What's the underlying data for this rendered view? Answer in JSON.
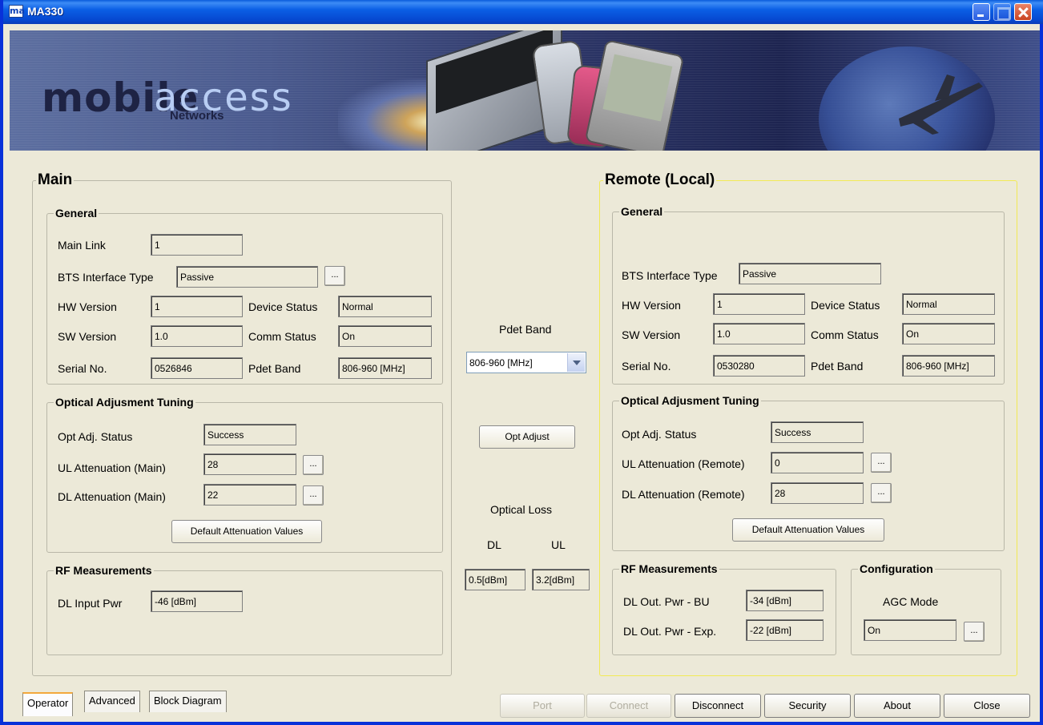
{
  "window": {
    "title": "MA330",
    "icon_text": "ma"
  },
  "banner": {
    "logo_mobile": "mobile",
    "logo_access": "access",
    "logo_networks": "Networks"
  },
  "main": {
    "title": "Main",
    "general": {
      "title": "General",
      "main_link_label": "Main Link",
      "main_link": "1",
      "bts_label": "BTS Interface Type",
      "bts": "Passive",
      "hw_label": "HW Version",
      "hw": "1",
      "sw_label": "SW Version",
      "sw": "1.0",
      "serial_label": "Serial No.",
      "serial": "0526846",
      "device_status_label": "Device Status",
      "device_status": "Normal",
      "comm_status_label": "Comm Status",
      "comm_status": "On",
      "pdet_label": "Pdet Band",
      "pdet": "806-960 [MHz]"
    },
    "optical": {
      "title": "Optical Adjusment Tuning",
      "status_label": "Opt Adj. Status",
      "status": "Success",
      "ul_label": "UL Attenuation (Main)",
      "ul": "28",
      "dl_label": "DL Attenuation (Main)",
      "dl": "22",
      "default_btn": "Default Attenuation Values"
    },
    "rf": {
      "title": "RF Measurements",
      "dl_input_label": "DL Input Pwr",
      "dl_input": "-46 [dBm]"
    }
  },
  "center": {
    "pdet_label": "Pdet Band",
    "pdet_selected": "806-960 [MHz]",
    "opt_adjust_btn": "Opt Adjust",
    "optical_loss_label": "Optical Loss",
    "dl_label": "DL",
    "ul_label": "UL",
    "dl_value": "0.5[dBm]",
    "ul_value": "3.2[dBm]"
  },
  "remote": {
    "title": "Remote (Local)",
    "general": {
      "title": "General",
      "bts_label": "BTS Interface Type",
      "bts": "Passive",
      "hw_label": "HW Version",
      "hw": "1",
      "sw_label": "SW Version",
      "sw": "1.0",
      "serial_label": "Serial No.",
      "serial": "0530280",
      "device_status_label": "Device Status",
      "device_status": "Normal",
      "comm_status_label": "Comm Status",
      "comm_status": "On",
      "pdet_label": "Pdet Band",
      "pdet": "806-960 [MHz]"
    },
    "optical": {
      "title": "Optical Adjusment Tuning",
      "status_label": "Opt Adj. Status",
      "status": "Success",
      "ul_label": "UL Attenuation (Remote)",
      "ul": "0",
      "dl_label": "DL Attenuation (Remote)",
      "dl": "28",
      "default_btn": "Default Attenuation Values"
    },
    "rf": {
      "title": "RF Measurements",
      "bu_label": "DL Out. Pwr - BU",
      "bu": "-34 [dBm]",
      "exp_label": "DL Out. Pwr - Exp.",
      "exp": "-22 [dBm]"
    },
    "config": {
      "title": "Configuration",
      "agc_label": "AGC Mode",
      "agc": "On"
    }
  },
  "dots_label": "...",
  "tabs": [
    "Operator",
    "Advanced",
    "Block Diagram"
  ],
  "bottom_buttons": {
    "port": "Port",
    "connect": "Connect",
    "disconnect": "Disconnect",
    "security": "Security",
    "about": "About",
    "close": "Close"
  },
  "colors": {
    "title_bar": "#0b5fe5",
    "background": "#ece9d8",
    "remote_border": "#f2ea55"
  }
}
